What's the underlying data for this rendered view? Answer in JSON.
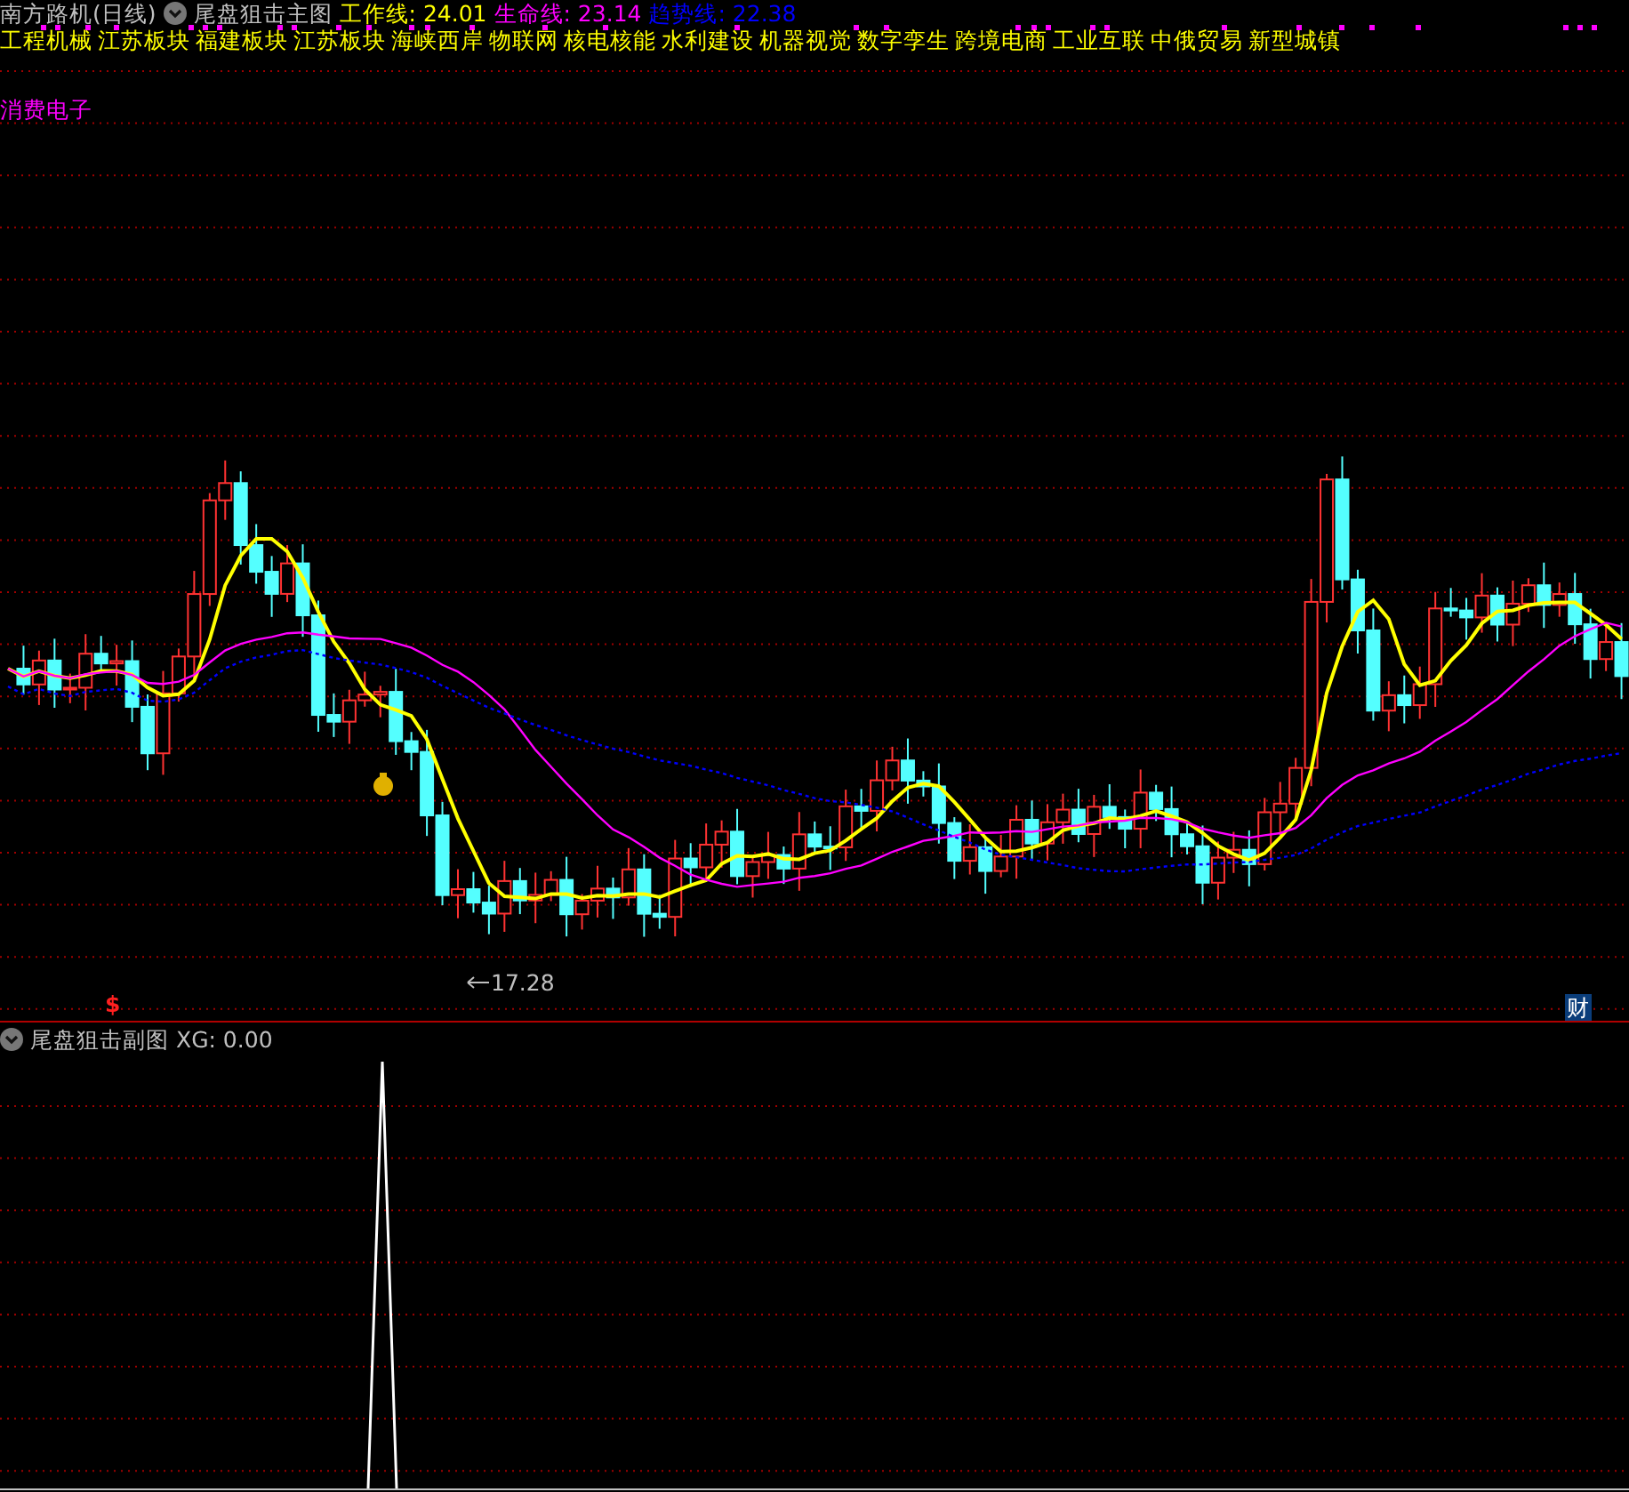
{
  "header": {
    "stock": "南方路机(日线)",
    "indicator": "尾盘狙击主图",
    "lines": [
      {
        "text": "工作线: 24.01",
        "color": "#ffff00"
      },
      {
        "text": "生命线: 23.14",
        "color": "#ff00ff"
      },
      {
        "text": "趋势线: 22.38",
        "color": "#0000ff"
      }
    ]
  },
  "concepts": [
    "工程机械",
    "江苏板块",
    "福建板块",
    "江苏板块",
    "海峡西岸",
    "物联网",
    "核电核能",
    "水利建设",
    "机器视觉",
    "数字孪生",
    "跨境电商",
    "工业互联",
    "中俄贸易",
    "新型城镇"
  ],
  "concept_extra": "消费电子",
  "main_chart": {
    "low_label": "17.28",
    "signal_mark": "$",
    "finance_badge": "财"
  },
  "sub_panel": {
    "indicator": "尾盘狙击副图",
    "reading": "XG: 0.00"
  }
}
